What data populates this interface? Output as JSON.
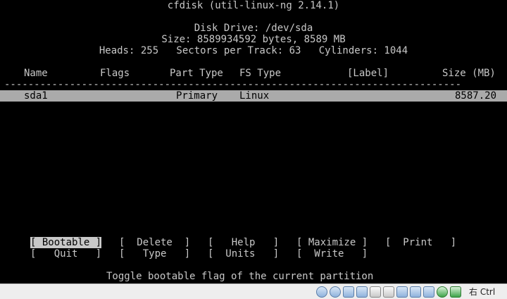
{
  "console": {
    "title": "cfdisk (util-linux-ng 2.14.1)",
    "disk_drive": "Disk Drive: /dev/sda",
    "size_line": "Size: 8589934592 bytes, 8589 MB",
    "geometry_line": "Heads: 255   Sectors per Track: 63   Cylinders: 1044",
    "columns": {
      "name": "Name",
      "flags": "Flags",
      "part_type": "Part Type",
      "fs_type": "FS Type",
      "label": "[Label]",
      "size": "Size (MB)"
    },
    "separator": "-----------------------------------------------------------------------------",
    "partitions": [
      {
        "name": "sda1",
        "flags": "",
        "part_type": "Primary",
        "fs_type": "Linux",
        "label": "",
        "size": "8587.20"
      }
    ],
    "menu": {
      "row1": [
        "[ Bootable ]",
        "[  Delete  ]",
        "[   Help   ]",
        "[ Maximize ]",
        "[  Print   ]"
      ],
      "row2": [
        "[   Quit   ]",
        "[   Type   ]",
        "[  Units   ]",
        "[  Write   ]"
      ]
    },
    "help_text": "Toggle bootable flag of the current partition"
  },
  "statusbar": {
    "host_key": "右 Ctrl",
    "icons": [
      "hard-disk-icon",
      "optical-disk-icon",
      "usb-icon",
      "shared-folders-icon",
      "pencil-icon",
      "display-icon",
      "record-icon",
      "vt-x-icon",
      "network-icon",
      "mouse-integration-icon",
      "arrow-down-icon"
    ]
  },
  "colors": {
    "background": "#000000",
    "text": "#c8c8c8",
    "highlight": "#aaaaaa",
    "statusbar": "#eeeeee"
  }
}
